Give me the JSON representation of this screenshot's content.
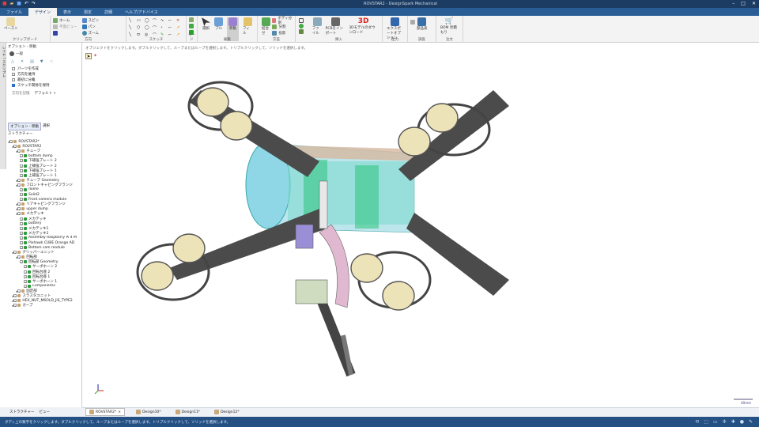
{
  "app": {
    "title": "ROVSTAR2 - DesignSpark Mechanical"
  },
  "ribbon_tabs": [
    "ファイル",
    "デザイン",
    "表示",
    "測定",
    "詳細",
    "ヘルプ/アドバイス"
  ],
  "ribbon_groups": [
    {
      "label": "クリップボード",
      "buttons": [
        "ペースト"
      ]
    },
    {
      "label": "方向",
      "buttons": [
        "ホーム",
        "平面ビュー",
        "ズーム",
        "スピン",
        "パン"
      ]
    },
    {
      "label": "スケッチ",
      "buttons": []
    },
    {
      "label": "モード",
      "buttons": []
    },
    {
      "label": "編集",
      "buttons": [
        "選択",
        "プル",
        "移動",
        "フィル"
      ]
    },
    {
      "label": "交差",
      "buttons": [
        "結合せ",
        "ボディ分割",
        "分割",
        "投影"
      ]
    },
    {
      "label": "挿入",
      "buttons": [
        "ファイル",
        "PCBをインポート",
        "3Dモデルのダウンロード"
      ]
    },
    {
      "label": "出力",
      "buttons": [
        "エクスポートオプション"
      ]
    },
    {
      "label": "調査",
      "buttons": [
        "部品表"
      ]
    },
    {
      "label": "注文",
      "buttons": [
        "BOM 見積もり"
      ]
    }
  ],
  "options_panel": {
    "title": "オプション - 移動",
    "section": "一般",
    "checkboxes": [
      {
        "label": "パーツを作成",
        "checked": false
      },
      {
        "label": "方向を維持",
        "checked": false
      },
      {
        "label": "最初に分離",
        "checked": false
      },
      {
        "label": "スケッチ関係を保持",
        "checked": true
      }
    ],
    "measure_label": "方向を記憶",
    "measure_value": "デフォルト"
  },
  "panel_tabs": [
    "オプション - 移動",
    "選択"
  ],
  "structure": {
    "title": "ストラクチャー",
    "items": [
      {
        "d": 0,
        "t": "ROVSTAR2*"
      },
      {
        "d": 1,
        "t": "ROVSTAR2"
      },
      {
        "d": 2,
        "t": "チューブ"
      },
      {
        "d": 3,
        "t": "bottom dump"
      },
      {
        "d": 3,
        "t": "下補強プレート 2"
      },
      {
        "d": 3,
        "t": "上補強プレート 2"
      },
      {
        "d": 3,
        "t": "下補強プレート 1"
      },
      {
        "d": 3,
        "t": "上補強プレート 1"
      },
      {
        "d": 2,
        "t": "チューブ Geometry"
      },
      {
        "d": 2,
        "t": "フロントキャピングフランジ"
      },
      {
        "d": 3,
        "t": "dome"
      },
      {
        "d": 3,
        "t": "Solid2"
      },
      {
        "d": 3,
        "t": "Front camera module"
      },
      {
        "d": 2,
        "t": "リアキャピングフランジ"
      },
      {
        "d": 2,
        "t": "upper dump"
      },
      {
        "d": 2,
        "t": "メカデッキ"
      },
      {
        "d": 3,
        "t": "メカデッキ"
      },
      {
        "d": 3,
        "t": "battery"
      },
      {
        "d": 3,
        "t": "メカデッキ1"
      },
      {
        "d": 3,
        "t": "メカデッキ2"
      },
      {
        "d": 3,
        "t": "Assembly Raspberry Pi 4 M"
      },
      {
        "d": 3,
        "t": "Pixhawk CUBE Orange AD"
      },
      {
        "d": 3,
        "t": "Bottom cam module"
      },
      {
        "d": 1,
        "t": "グリッパーユニット"
      },
      {
        "d": 2,
        "t": "回転部"
      },
      {
        "d": 3,
        "t": "回転部 Geometry"
      },
      {
        "d": 4,
        "t": "サーボホーン 2"
      },
      {
        "d": 4,
        "t": "回転台座 2"
      },
      {
        "d": 4,
        "t": "回転台座 1"
      },
      {
        "d": 4,
        "t": "サーボホーン 1"
      },
      {
        "d": 4,
        "t": "Component2"
      },
      {
        "d": 2,
        "t": "固定部"
      },
      {
        "d": 1,
        "t": "スラスタユニット"
      },
      {
        "d": 1,
        "t": "HEX_NUT_M6OLD_JIS_TYPE2"
      },
      {
        "d": 1,
        "t": "カーブ"
      }
    ]
  },
  "left_bottom_tabs": [
    "ストラクチャー",
    "ビュー"
  ],
  "viewport": {
    "hint": "オブジェクトをクリックします。ダブルクリックして、ループまたはループを選択します。トリプルクリックして、ソリッドを選択します。",
    "scale": "40mm"
  },
  "doc_tabs": [
    "ROVSTAR2*",
    "Design10*",
    "Design11*",
    "Design12*"
  ],
  "status": {
    "text": "ボディ上の数字をクリックします。ダブルクリックして、ループまたはループを選択します。トリプルクリックして、ソリッドを選択します。"
  }
}
